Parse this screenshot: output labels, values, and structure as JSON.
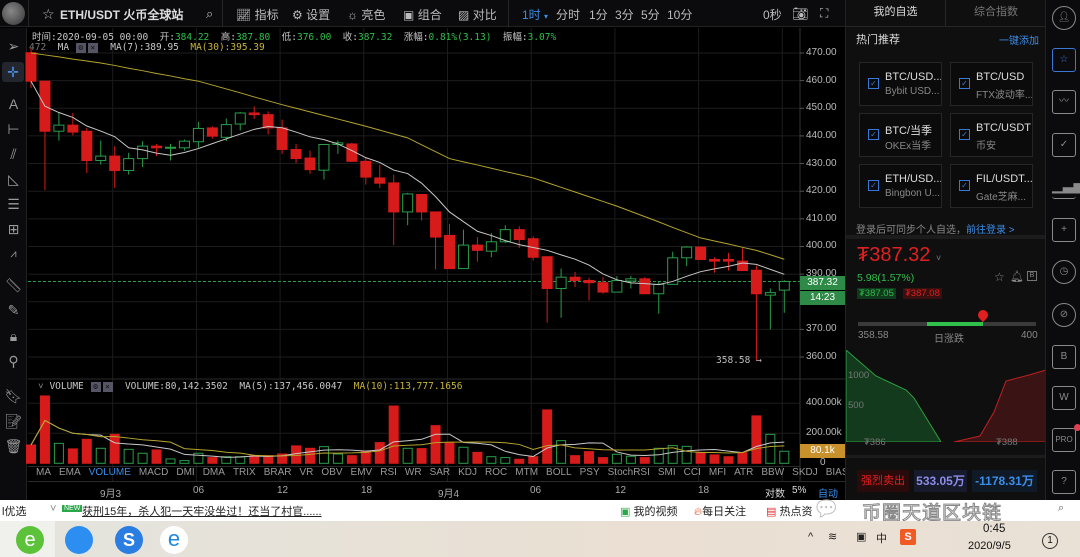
{
  "header": {
    "pair": "ETH/USDT",
    "exchange": "火币全球站",
    "menu": [
      {
        "icon": "indicator-icon",
        "label": "指标"
      },
      {
        "icon": "gear-icon",
        "label": "设置"
      },
      {
        "icon": "sun-icon",
        "label": "亮色"
      },
      {
        "icon": "combine-icon",
        "label": "组合"
      },
      {
        "icon": "compare-icon",
        "label": "对比"
      }
    ],
    "interval_selected": "1时",
    "intervals": [
      "分时",
      "1分",
      "3分",
      "5分",
      "10分"
    ],
    "countdown": "0秒"
  },
  "info": {
    "time_label": "时间:",
    "time": "2020-09-05 00:00",
    "open_label": "开:",
    "open": "384.22",
    "high_label": "高:",
    "high": "387.80",
    "low_label": "低:",
    "low": "376.00",
    "close_label": "收:",
    "close": "387.32",
    "change_label": "涨幅:",
    "change": "0.81%(3.13)",
    "amp_label": "振幅:",
    "amp": "3.07%"
  },
  "ma": {
    "left_cut": "472",
    "label": "MA",
    "ma7": "MA(7):389.95",
    "ma30": "MA(30):395.39"
  },
  "volume": {
    "label": "VOLUME",
    "value": "VOLUME:80,142.3502",
    "ma5": "MA(5):137,456.0047",
    "ma10": "MA(10):113,777.1656"
  },
  "price_axis": [
    "470.00",
    "460.00",
    "450.00",
    "440.00",
    "430.00",
    "420.00",
    "410.00",
    "400.00",
    "390.00",
    "370.00",
    "360.00"
  ],
  "last_price_badge": "387.32",
  "countdown_badge": "14:23",
  "low_marker": "358.58",
  "volume_axis": [
    "400.00k",
    "200.00k",
    "0"
  ],
  "volume_badge": "80.1k",
  "indicators": [
    "MA",
    "EMA",
    "VOLUME",
    "MACD",
    "DMI",
    "DMA",
    "TRIX",
    "BRAR",
    "VR",
    "OBV",
    "EMV",
    "RSI",
    "WR",
    "SAR",
    "KDJ",
    "ROC",
    "MTM",
    "BOLL",
    "PSY",
    "StochRSI",
    "SMI",
    "CCI",
    "MFI",
    "ATR",
    "BBW",
    "SKDJ",
    "BIAS"
  ],
  "indicator_active": "VOLUME",
  "time_axis": [
    "9月3",
    "06",
    "12",
    "18",
    "9月4",
    "06",
    "12",
    "18"
  ],
  "scale_opts": {
    "log": "对数",
    "pct": "5%",
    "auto": "自动"
  },
  "colors": {
    "up": "#2a9d48",
    "down": "#d71a1a",
    "ma7": "#c8c8c8",
    "ma30": "#b5a42c",
    "accent": "#3a78d8",
    "vol_badge": "#c8912b"
  },
  "chart_data": {
    "type": "candlestick",
    "ylim": [
      355,
      475
    ],
    "candles_ohlc": [
      [
        470.1,
        472,
        457.3,
        459.8
      ],
      [
        459.8,
        459.8,
        420.4,
        441.7
      ],
      [
        441.7,
        448.3,
        438.3,
        443.9
      ],
      [
        443.9,
        448.3,
        440.2,
        441.4
      ],
      [
        441.7,
        442.9,
        426.6,
        431.1
      ],
      [
        431.1,
        438.3,
        429.6,
        432.7
      ],
      [
        432.7,
        436.3,
        421.2,
        427.5
      ],
      [
        427.5,
        433.9,
        426,
        431.8
      ],
      [
        431.8,
        438.1,
        428.7,
        436.3
      ],
      [
        436.3,
        437.1,
        432.7,
        435.7
      ],
      [
        435.7,
        437.1,
        431.1,
        435.9
      ],
      [
        435.7,
        438.7,
        434.7,
        438.1
      ],
      [
        437.9,
        445.1,
        435.7,
        442.7
      ],
      [
        442.9,
        443.5,
        439,
        439.9
      ],
      [
        439.5,
        446.3,
        438.1,
        444.1
      ],
      [
        444.3,
        448.7,
        442,
        448.3
      ],
      [
        448.3,
        450.7,
        446.1,
        447.7
      ],
      [
        447.7,
        448.9,
        440.5,
        442.9
      ],
      [
        442.9,
        445.9,
        433.5,
        435.1
      ],
      [
        435.1,
        437.1,
        430.2,
        431.8
      ],
      [
        432,
        434.7,
        426.3,
        427.8
      ],
      [
        427.6,
        436.9,
        424.2,
        436.9
      ],
      [
        436.9,
        438.3,
        433.5,
        437.5
      ],
      [
        437.1,
        437.5,
        430.8,
        430.8
      ],
      [
        430.8,
        432,
        422.4,
        425.1
      ],
      [
        424.8,
        429.6,
        421.2,
        422.9
      ],
      [
        423,
        426,
        400.5,
        412.5
      ],
      [
        412.5,
        419.4,
        407.7,
        419
      ],
      [
        418.8,
        418.8,
        409.4,
        412.5
      ],
      [
        412.5,
        412.5,
        391.7,
        403.4
      ],
      [
        404,
        408.2,
        392,
        392
      ],
      [
        392,
        406.1,
        392,
        400.5
      ],
      [
        400.5,
        403.4,
        394.5,
        398.6
      ],
      [
        398.3,
        404.9,
        396.1,
        401.7
      ],
      [
        401.7,
        407.7,
        401.3,
        406.1
      ],
      [
        406.1,
        407.3,
        399.5,
        402.5
      ],
      [
        402.8,
        403.7,
        394.9,
        396.1
      ],
      [
        396.3,
        396.3,
        372.4,
        384.8
      ],
      [
        384.8,
        392,
        374.2,
        388.9
      ],
      [
        388.9,
        390.8,
        385.3,
        387.7
      ],
      [
        387.7,
        388.7,
        380.5,
        386.9
      ],
      [
        386.9,
        388.9,
        382.9,
        383.5
      ],
      [
        383.5,
        389.3,
        383.5,
        387.7
      ],
      [
        387.5,
        389.3,
        384.8,
        388.3
      ],
      [
        388.3,
        388.9,
        382.9,
        382.9
      ],
      [
        382.9,
        387.5,
        375.7,
        386.3
      ],
      [
        386.3,
        398.1,
        386.3,
        395.9
      ],
      [
        395.9,
        400.1,
        392.9,
        399.8
      ],
      [
        399.8,
        399.8,
        395.3,
        395.3
      ],
      [
        395.3,
        396.1,
        390.5,
        394.7
      ],
      [
        395.3,
        397.7,
        391.3,
        394.7
      ],
      [
        394.7,
        399.3,
        391.3,
        391.3
      ],
      [
        391.4,
        393.1,
        358.58,
        382.9
      ],
      [
        382.4,
        384.8,
        370,
        383.3
      ],
      [
        384.22,
        387.8,
        376,
        387.32
      ]
    ],
    "ma30": [
      470,
      469.3,
      468.6,
      467.8,
      467.1,
      466.4,
      465.5,
      464.5,
      463.6,
      462.6,
      461.7,
      460.7,
      459.8,
      458.4,
      457,
      455.6,
      454.1,
      452.7,
      451.3,
      450,
      448.7,
      447.4,
      446.1,
      444.8,
      443.5,
      442.1,
      440.7,
      439.3,
      436.8,
      434.3,
      431.8,
      430.6,
      429.5,
      428.3,
      427.1,
      426,
      424.8,
      423.1,
      421.4,
      419.7,
      418,
      416.3,
      414.6,
      412.7,
      410.8,
      408.9,
      406.9,
      405,
      403.1,
      402,
      400.9,
      399.7,
      398.6,
      397,
      395.39
    ],
    "volume_k": [
      122,
      449,
      133,
      96,
      160,
      100,
      193,
      93,
      67,
      89,
      29,
      18,
      67,
      38,
      44,
      44,
      51,
      51,
      62,
      116,
      100,
      111,
      62,
      51,
      82,
      138,
      382,
      100,
      98,
      251,
      138,
      107,
      73,
      44,
      38,
      27,
      44,
      356,
      151,
      51,
      78,
      38,
      60,
      47,
      38,
      100,
      118,
      113,
      73,
      56,
      44,
      71,
      316,
      193,
      80.14
    ],
    "volume_ylim": [
      0,
      450
    ]
  },
  "right_panel": {
    "tabs": [
      "我的自选",
      "综合指数"
    ],
    "hot_title": "热门推荐",
    "add_all": "一键添加",
    "cards": [
      {
        "pair": "BTC/USD...",
        "sub": "Bybit USD..."
      },
      {
        "pair": "BTC/USD",
        "sub": "FTX波动率..."
      },
      {
        "pair": "BTC/当季",
        "sub": "OKEx当季"
      },
      {
        "pair": "BTC/USDT",
        "sub": "币安"
      },
      {
        "pair": "ETH/USD...",
        "sub": "Bingbon U..."
      },
      {
        "pair": "FIL/USDT...",
        "sub": "Gate芝麻..."
      }
    ],
    "login_hint": "登录后可同步个人自选，",
    "login_link": "前往登录 >",
    "price": "₮387.32",
    "change": "5.98(1.57%)",
    "bid": "₮387.05",
    "ask": "₮387.08",
    "range_low": "358.58",
    "range_label": "日涨跌",
    "range_high": "400",
    "range_position": 0.7,
    "depth_labels": [
      "1000",
      "500"
    ],
    "depth_bid_price": "₮386",
    "depth_ask_price": "₮388",
    "signal": "强烈卖出",
    "inflow": "533.05万",
    "netflow": "-1178.31万"
  },
  "right_icons": [
    "user-icon",
    "watchlist-star-icon",
    "market-chart-icon",
    "doc-check-icon",
    "bar-chart-icon",
    "add-doc-icon",
    "alarm-icon",
    "planet-icon",
    "doc-b-icon",
    "w-icon",
    "pro-icon",
    "help-icon"
  ],
  "browser": {
    "left": "l优选",
    "news_badge": "NEW",
    "news": "获刑15年，杀人犯一天牢没坐过！还当了村官......",
    "links": [
      "我的视频",
      "每日关注",
      "热点资"
    ],
    "watermark": "币圈天道区块链"
  },
  "taskbar": {
    "time": "0:45",
    "date": "2020/9/5",
    "ime": "中",
    "notif": "1"
  }
}
